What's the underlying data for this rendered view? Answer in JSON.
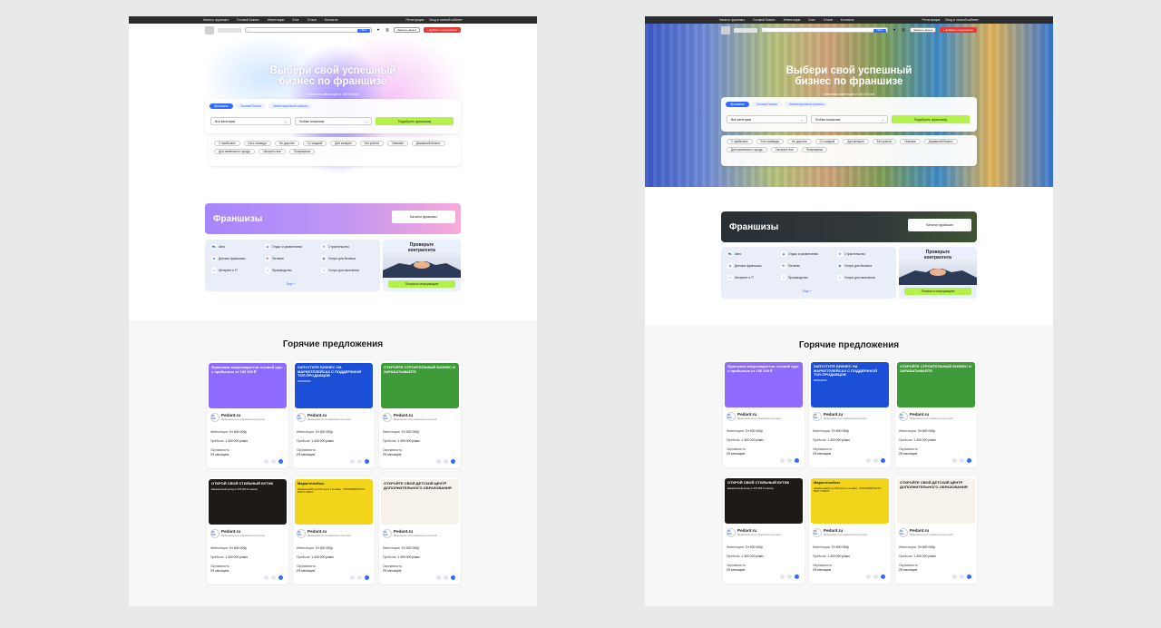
{
  "topnav": {
    "items": [
      "Каталог франшиз",
      "Готовый бизнес",
      "Инвестиции",
      "Блог",
      "Отзыв",
      "Контакты"
    ],
    "right": [
      "Регистрация",
      "Вход в личный кабинет"
    ]
  },
  "header": {
    "search_button": "Найти",
    "contact_button": "Заказать звонок",
    "add_button": "+ Добавить предложение"
  },
  "hero": {
    "title_line1": "Выбери свой успешный",
    "title_line2": "бизнес по франшизе",
    "subtitle": "с объемом инвестиций от 100 000 руб.",
    "tabs": [
      "Франшизы",
      "Готовый бизнес",
      "Инвестиционные проекты"
    ],
    "select_category": "Все категории",
    "select_invest": "Любые вложения",
    "pick_button": "Подобрать франшизу"
  },
  "chips": [
    "С прибылью",
    "Есть команда",
    "Не дорогие",
    "Со скидкой",
    "Для женщин",
    "Без роялти",
    "Новинки",
    "Домашний бизнес",
    "Для маленького города",
    "Смотреть все",
    "Популярные"
  ],
  "franchises": {
    "title": "Франшизы",
    "catalog_button": "Каталог франшиз",
    "more": "Еще +"
  },
  "categories": [
    "Авто",
    "Отдых и развлечения",
    "Строительство",
    "Детские франшизы",
    "Питание",
    "Услуги для бизнеса",
    "Интернет и IT",
    "Производство",
    "Услуги для населения"
  ],
  "check": {
    "title_line1": "Проверьте",
    "title_line2": "контрагента",
    "button": "Получить информацию"
  },
  "hot": {
    "title": "Горячие предложения"
  },
  "offers": [
    {
      "headline": "Франшиза микромаркетов готовой еды с прибылью от 150 000 ₽",
      "sub": "",
      "name": "Pedant.ru",
      "desc": "Франшиза сети сервисных центров",
      "invest_label": "Инвестиции:",
      "invest": "От 600 000р",
      "profit_label": "Прибыль:",
      "profit": "1 400 000 р/мес",
      "payback_label": "Окупаемость:",
      "payback": "29 месяцев",
      "logo": "DE Pad",
      "bg": "#8f6bff"
    },
    {
      "headline": "ЗАПУСТИТЕ БИЗНЕС НА МАРКЕТПЛЕЙСАХ С ПОДДЕРЖКОЙ ТОП-ПРОДАВЦОВ",
      "sub": "ФРАНШИЗА",
      "name": "Pedant.ru",
      "desc": "Франшиза сети сервисных центров",
      "invest_label": "Инвестиции:",
      "invest": "От 600 000р",
      "profit_label": "Прибыль:",
      "profit": "1 400 000 р/мес",
      "payback_label": "Окупаемость:",
      "payback": "29 месяцев",
      "logo": "DE Pad",
      "bg": "#1b4fd8"
    },
    {
      "headline": "ОТКРОЙТЕ СТРОИТЕЛЬНЫЙ БИЗНЕС И ЗАРАБАТЫВАЙТЕ",
      "sub": "",
      "name": "Pedant.ru",
      "desc": "Франшиза сети сервисных центров",
      "invest_label": "Инвестиции:",
      "invest": "От 600 000р",
      "profit_label": "Прибыль:",
      "profit": "1 400 000 р/мес",
      "payback_label": "Окупаемость:",
      "payback": "29 месяцев",
      "logo": "DE Pad",
      "bg": "#3f9a3a"
    },
    {
      "headline": "ОТКРОЙ СВОЙ СТИЛЬНЫЙ БУТИК",
      "sub": "Ежемесячный доход от 370 000 ₽ в месяц",
      "name": "Pedant.ru",
      "desc": "Франшиза сети сервисных центров",
      "invest_label": "Инвестиции:",
      "invest": "От 600 000р",
      "profit_label": "Прибыль:",
      "profit": "1 400 000 р/мес",
      "payback_label": "Окупаемость:",
      "payback": "29 месяцев",
      "logo": "DE Pad",
      "bg": "#1d1a17"
    },
    {
      "headline": "Маркетплейсы",
      "sub": "Зарабатывайте до 150 тысяч в онлайне · ОПЛАЧИВАЙТЕ ПО ФАКТУ РАБОТ",
      "name": "Pedant.ru",
      "desc": "Франшиза сети сервисных центров",
      "invest_label": "Инвестиции:",
      "invest": "От 600 000р",
      "profit_label": "Прибыль:",
      "profit": "1 400 000 р/мес",
      "payback_label": "Окупаемость:",
      "payback": "29 месяцев",
      "logo": "DE Pad",
      "bg": "#f2d51b"
    },
    {
      "headline": "ОТКРОЙТЕ СВОЙ ДЕТСКИЙ ЦЕНТР ДОПОЛНИТЕЛЬНОГО ОБРАЗОВАНИЯ",
      "sub": "",
      "name": "Pedant.ru",
      "desc": "Франшиза сети сервисных центров",
      "invest_label": "Инвестиции:",
      "invest": "От 600 000р",
      "profit_label": "Прибыль:",
      "profit": "1 400 000 р/мес",
      "payback_label": "Окупаемость:",
      "payback": "29 месяцев",
      "logo": "DE Pad",
      "bg": "#f7f3ea"
    }
  ]
}
